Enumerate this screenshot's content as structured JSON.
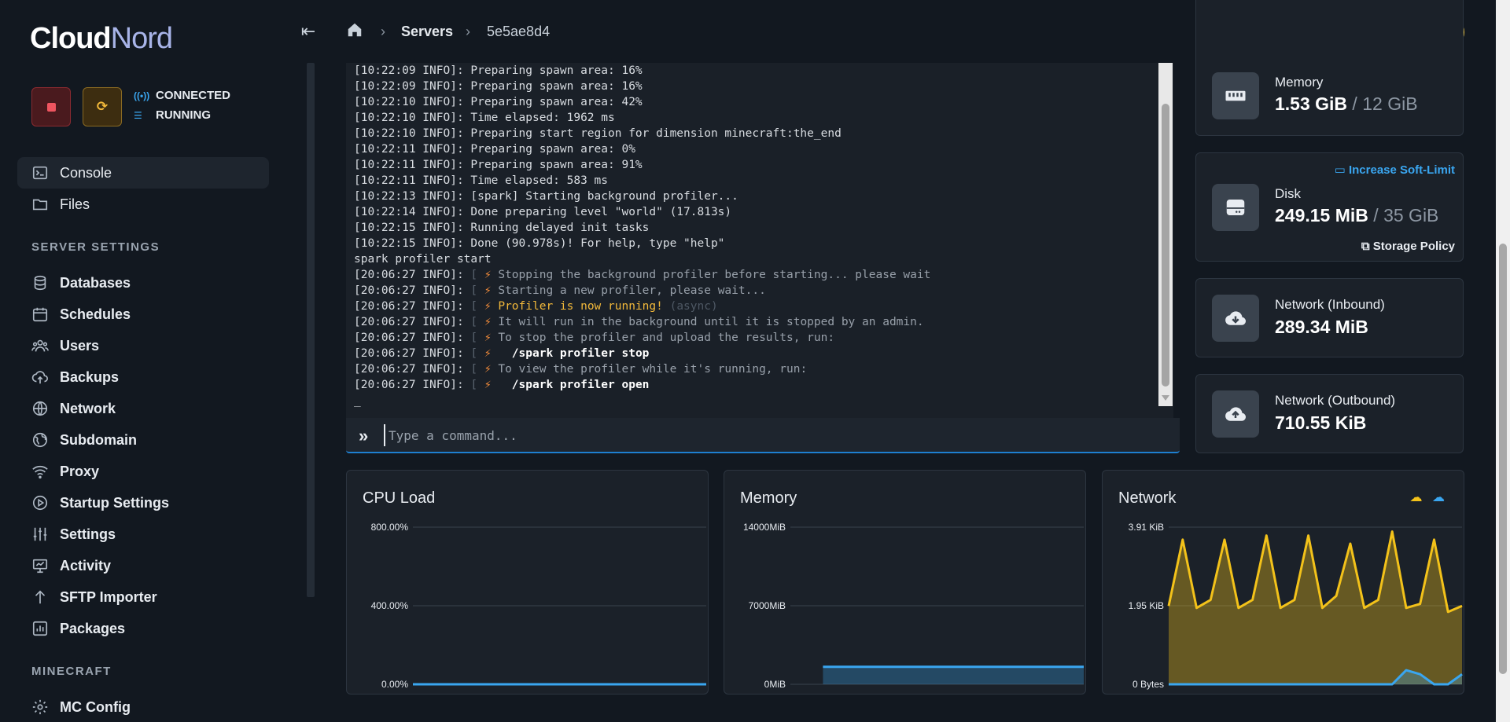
{
  "brand": {
    "part1": "Cloud",
    "part2": "Nord"
  },
  "server_status": {
    "connection": "CONNECTED",
    "state": "RUNNING"
  },
  "breadcrumb": {
    "servers": "Servers",
    "server_id": "5e5ae8d4"
  },
  "sidebar": {
    "top_items": [
      {
        "label": "Console",
        "icon": "terminal-icon"
      },
      {
        "label": "Files",
        "icon": "folder-icon"
      }
    ],
    "server_settings_title": "SERVER SETTINGS",
    "settings_items": [
      {
        "label": "Databases",
        "icon": "database-icon"
      },
      {
        "label": "Schedules",
        "icon": "calendar-icon"
      },
      {
        "label": "Users",
        "icon": "users-icon"
      },
      {
        "label": "Backups",
        "icon": "cloud-upload-icon"
      },
      {
        "label": "Network",
        "icon": "globe-icon"
      },
      {
        "label": "Subdomain",
        "icon": "world-icon"
      },
      {
        "label": "Proxy",
        "icon": "wifi-icon"
      },
      {
        "label": "Startup Settings",
        "icon": "play-circle-icon"
      },
      {
        "label": "Settings",
        "icon": "sliders-icon"
      },
      {
        "label": "Activity",
        "icon": "presentation-icon"
      },
      {
        "label": "SFTP Importer",
        "icon": "arrow-up-icon"
      },
      {
        "label": "Packages",
        "icon": "chart-box-icon"
      }
    ],
    "minecraft_title": "MINECRAFT",
    "minecraft_items": [
      {
        "label": "MC Config",
        "icon": "gear-icon"
      }
    ]
  },
  "console": {
    "lines": [
      {
        "prefix": "[10:22:09 INFO]: ",
        "text": "Preparing spawn area: 16%"
      },
      {
        "prefix": "[10:22:09 INFO]: ",
        "text": "Preparing spawn area: 16%"
      },
      {
        "prefix": "[10:22:10 INFO]: ",
        "text": "Preparing spawn area: 42%"
      },
      {
        "prefix": "[10:22:10 INFO]: ",
        "text": "Time elapsed: 1962 ms"
      },
      {
        "prefix": "[10:22:10 INFO]: ",
        "text": "Preparing start region for dimension minecraft:the_end"
      },
      {
        "prefix": "[10:22:11 INFO]: ",
        "text": "Preparing spawn area: 0%"
      },
      {
        "prefix": "[10:22:11 INFO]: ",
        "text": "Preparing spawn area: 91%"
      },
      {
        "prefix": "[10:22:11 INFO]: ",
        "text": "Time elapsed: 583 ms"
      },
      {
        "prefix": "[10:22:13 INFO]: ",
        "text": "[spark] Starting background profiler..."
      },
      {
        "prefix": "[10:22:14 INFO]: ",
        "text": "Done preparing level \"world\" (17.813s)"
      },
      {
        "prefix": "[10:22:15 INFO]: ",
        "text": "Running delayed init tasks"
      },
      {
        "prefix": "[10:22:15 INFO]: ",
        "text": "Done (90.978s)! For help, type \"help\""
      },
      {
        "prefix": "",
        "text": "spark profiler start"
      }
    ],
    "spark_lines": [
      {
        "prefix": "[20:06:27 INFO]: ",
        "text": "Stopping the background profiler before starting... please wait",
        "style": "dim",
        "extra": ""
      },
      {
        "prefix": "[20:06:27 INFO]: ",
        "text": "Starting a new profiler, please wait...",
        "style": "dim",
        "extra": ""
      },
      {
        "prefix": "[20:06:27 INFO]: ",
        "text": "Profiler is now running!",
        "style": "warn",
        "extra": "(async)"
      },
      {
        "prefix": "[20:06:27 INFO]: ",
        "text": "It will run in the background until it is stopped by an admin.",
        "style": "dim",
        "extra": ""
      },
      {
        "prefix": "[20:06:27 INFO]: ",
        "text": "To stop the profiler and upload the results, run:",
        "style": "dim",
        "extra": ""
      },
      {
        "prefix": "[20:06:27 INFO]: ",
        "text": "  /spark profiler stop",
        "style": "cmd",
        "extra": ""
      },
      {
        "prefix": "[20:06:27 INFO]: ",
        "text": "To view the profiler while it's running, run:",
        "style": "dim",
        "extra": ""
      },
      {
        "prefix": "[20:06:27 INFO]: ",
        "text": "  /spark profiler open",
        "style": "cmd",
        "extra": ""
      }
    ],
    "cursor": "_",
    "command_placeholder": "Type a command..."
  },
  "stats": {
    "memory": {
      "label": "Memory",
      "used": "1.53 GiB",
      "limit": " / 12 GiB"
    },
    "disk": {
      "label": "Disk",
      "used": "249.15 MiB",
      "limit": " / 35 GiB",
      "increase_link": "Increase Soft-Limit",
      "policy_link": "Storage Policy"
    },
    "net_in": {
      "label": "Network (Inbound)",
      "value": "289.34 MiB"
    },
    "net_out": {
      "label": "Network (Outbound)",
      "value": "710.55 KiB"
    }
  },
  "chart_data": [
    {
      "type": "line",
      "title": "CPU Load",
      "y_ticks": [
        "800.00%",
        "400.00%",
        "0.00%"
      ],
      "ylim": [
        0,
        800
      ],
      "series": [
        {
          "values": [
            0,
            0,
            0,
            0,
            0,
            0,
            0,
            0,
            0,
            0
          ],
          "color": "#3aa6f0"
        }
      ]
    },
    {
      "type": "area",
      "title": "Memory",
      "y_ticks": [
        "14000MiB",
        "7000MiB",
        "0MiB"
      ],
      "ylim": [
        0,
        14000
      ],
      "series": [
        {
          "values": [
            null,
            1560,
            1560,
            1560,
            1560,
            1560,
            1560,
            1560,
            1560,
            1560
          ],
          "color": "#3aa6f0"
        }
      ]
    },
    {
      "type": "area",
      "title": "Network",
      "y_ticks": [
        "3.91 KiB",
        "1.95 KiB",
        "0 Bytes"
      ],
      "ylim": [
        0,
        3.91
      ],
      "series": [
        {
          "values": [
            1.95,
            3.6,
            1.9,
            2.1,
            3.6,
            1.9,
            2.1,
            3.7,
            1.9,
            2.1,
            3.7,
            1.9,
            2.2,
            3.5,
            1.9,
            2.1,
            3.8,
            1.9,
            2.0,
            3.6,
            1.8,
            1.95
          ],
          "color": "#f3c21a"
        },
        {
          "values": [
            0,
            0,
            0,
            0,
            0,
            0,
            0,
            0,
            0,
            0,
            0,
            0,
            0,
            0,
            0,
            0,
            0,
            0.35,
            0.25,
            0.0,
            0.0,
            0.25
          ],
          "color": "#3aa6f0"
        }
      ]
    }
  ]
}
